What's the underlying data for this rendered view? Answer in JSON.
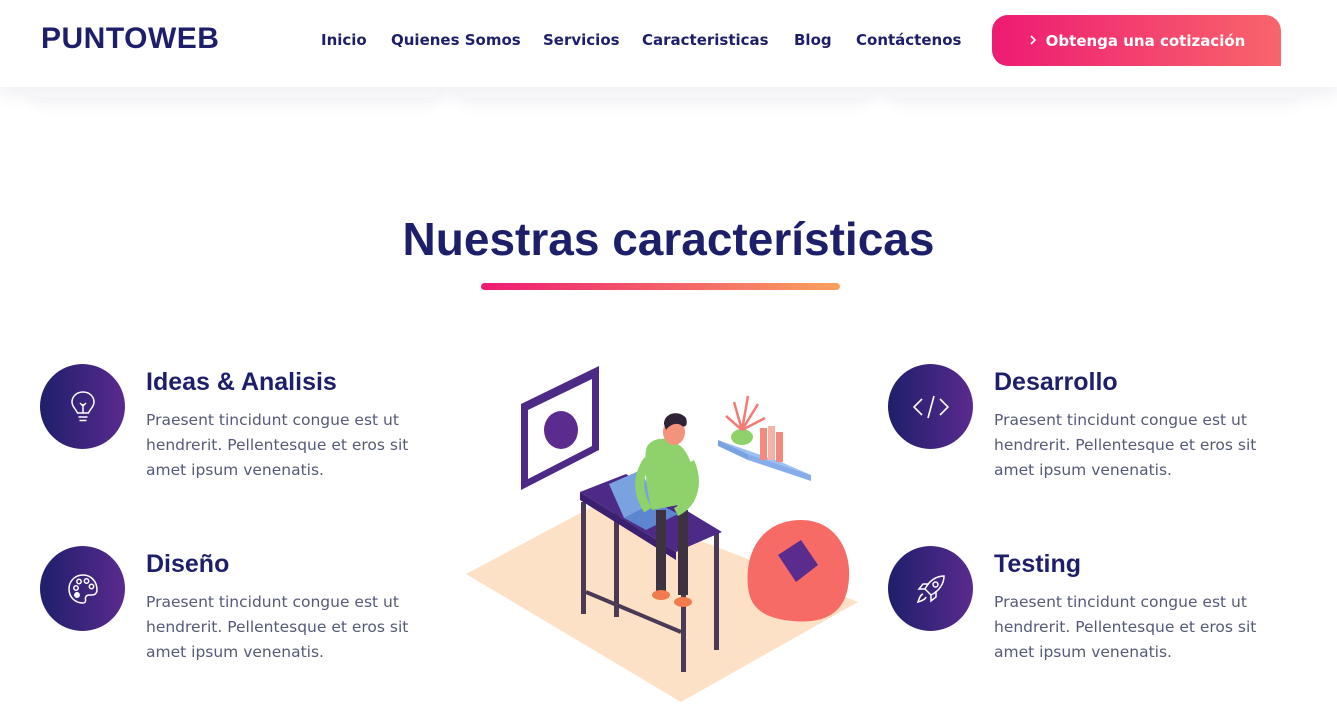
{
  "header": {
    "logo": "PUNTOWEB",
    "nav": [
      "Inicio",
      "Quienes Somos",
      "Servicios",
      "Caracteristicas",
      "Blog",
      "Contáctenos"
    ],
    "cta_label": "Obtenga una cotización",
    "cta_icon": "chevron-right-icon"
  },
  "section": {
    "title": "Nuestras características"
  },
  "features": [
    {
      "title": "Ideas & Analisis",
      "text": "Praesent tincidunt congue est ut hendrerit. Pellentesque et eros sit amet ipsum venenatis.",
      "icon": "lightbulb-icon"
    },
    {
      "title": "Diseño",
      "text": "Praesent tincidunt congue est ut hendrerit. Pellentesque et eros sit amet ipsum venenatis.",
      "icon": "palette-icon"
    },
    {
      "title": "Desarrollo",
      "text": "Praesent tincidunt congue est ut hendrerit. Pellentesque et eros sit amet ipsum venenatis.",
      "icon": "code-icon"
    },
    {
      "title": "Testing",
      "text": "Praesent tincidunt congue est ut hendrerit. Pellentesque et eros sit amet ipsum venenatis.",
      "icon": "rocket-icon"
    }
  ],
  "colors": {
    "navy": "#1e1f6b",
    "accent_start": "#ee1b73",
    "accent_end": "#f8656b",
    "underline_end": "#f9a05e",
    "body_text": "#555a79"
  }
}
